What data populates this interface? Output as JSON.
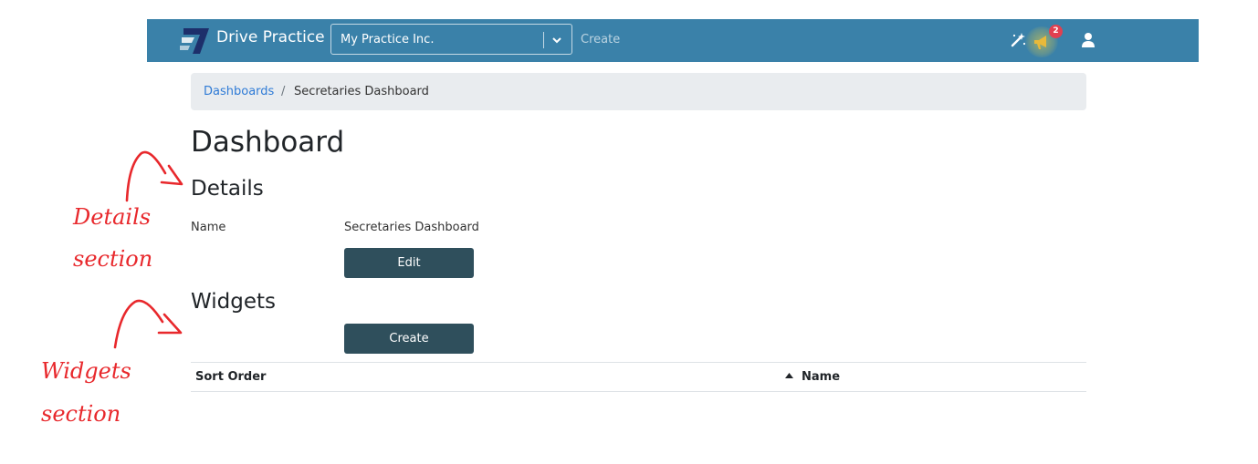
{
  "navbar": {
    "brand": "Drive Practice",
    "practice_select_value": "My Practice Inc.",
    "create_link": "Create",
    "notification_count": "2",
    "icons": [
      "magic-wand-icon",
      "megaphone-icon",
      "user-icon",
      "chevron-down-icon"
    ],
    "background_color": "#3a81a9"
  },
  "breadcrumb": {
    "link": "Dashboards",
    "separator": "/",
    "current": "Secretaries Dashboard"
  },
  "page": {
    "title": "Dashboard",
    "details_heading": "Details",
    "name_label": "Name",
    "name_value": "Secretaries Dashboard",
    "edit_button": "Edit",
    "widgets_heading": "Widgets",
    "create_button": "Create"
  },
  "table": {
    "columns": [
      "Sort Order",
      "Name"
    ],
    "sorted_column": "Name",
    "sort_direction": "ascending"
  },
  "annotations": {
    "details_line1": "Details",
    "details_line2": "section",
    "widgets_line1": "Widgets",
    "widgets_line2": "section",
    "color": "#e8282c"
  },
  "colors": {
    "button": "#2f4f5c",
    "link": "#2f7bd6",
    "badge": "#e04050",
    "breadcrumb_bg": "#e9ecef"
  }
}
